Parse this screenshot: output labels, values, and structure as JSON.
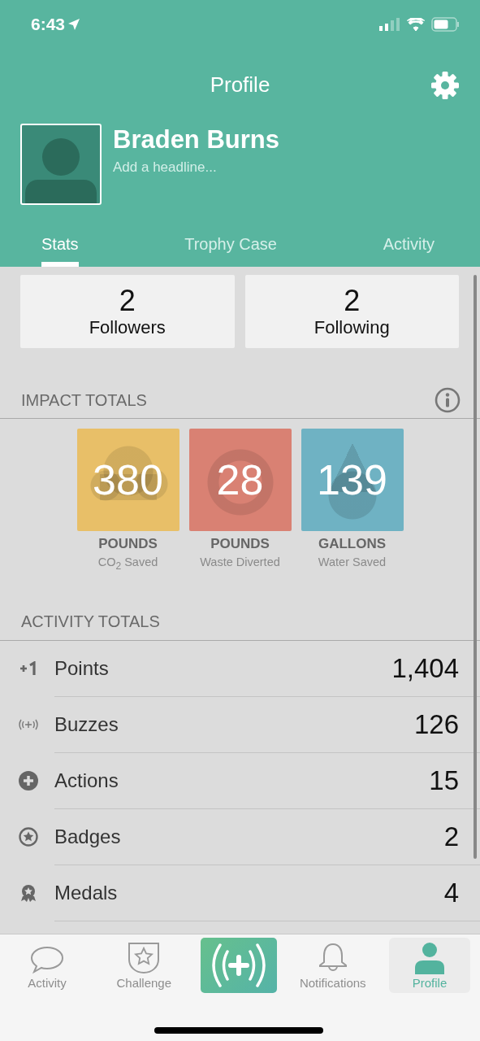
{
  "status_bar": {
    "time": "6:43"
  },
  "header": {
    "title": "Profile"
  },
  "profile": {
    "name": "Braden Burns",
    "headline": {
      "placeholder": "Add a headline..."
    }
  },
  "tabs": [
    {
      "label": "Stats",
      "selected": true
    },
    {
      "label": "Trophy Case",
      "selected": false
    },
    {
      "label": "Activity",
      "selected": false
    }
  ],
  "social": [
    {
      "count": "2",
      "label": "Followers"
    },
    {
      "count": "2",
      "label": "Following"
    }
  ],
  "impact": {
    "title": "IMPACT TOTALS",
    "tiles": [
      {
        "kind": "cloud",
        "color": "#e8bf68",
        "value": "380",
        "unit": "POUNDS",
        "caption": "CO$_{2}$ Saved"
      },
      {
        "kind": "recycle",
        "color": "#d98173",
        "value": "28",
        "unit": "POUNDS",
        "caption": "Waste Diverted"
      },
      {
        "kind": "drop",
        "color": "#6fb2c3",
        "value": "139",
        "unit": "GALLONS",
        "caption": "Water Saved"
      }
    ]
  },
  "activity": {
    "title": "ACTIVITY TOTALS",
    "rows": [
      {
        "kind": "points",
        "label": "Points",
        "value": "1,404"
      },
      {
        "kind": "buzzes",
        "label": "Buzzes",
        "value": "126"
      },
      {
        "kind": "actions",
        "label": "Actions",
        "value": "15"
      },
      {
        "kind": "badges",
        "label": "Badges",
        "value": "2"
      },
      {
        "kind": "medals",
        "label": "Medals",
        "value": "4"
      }
    ]
  },
  "nav": [
    {
      "kind": "chat",
      "label": "Activity",
      "selected": false
    },
    {
      "kind": "shield",
      "label": "Challenge",
      "selected": false
    },
    {
      "kind": "buzz",
      "selected": false
    },
    {
      "kind": "bell",
      "label": "Notifications",
      "selected": false
    },
    {
      "kind": "person",
      "label": "Profile",
      "selected": true
    }
  ]
}
